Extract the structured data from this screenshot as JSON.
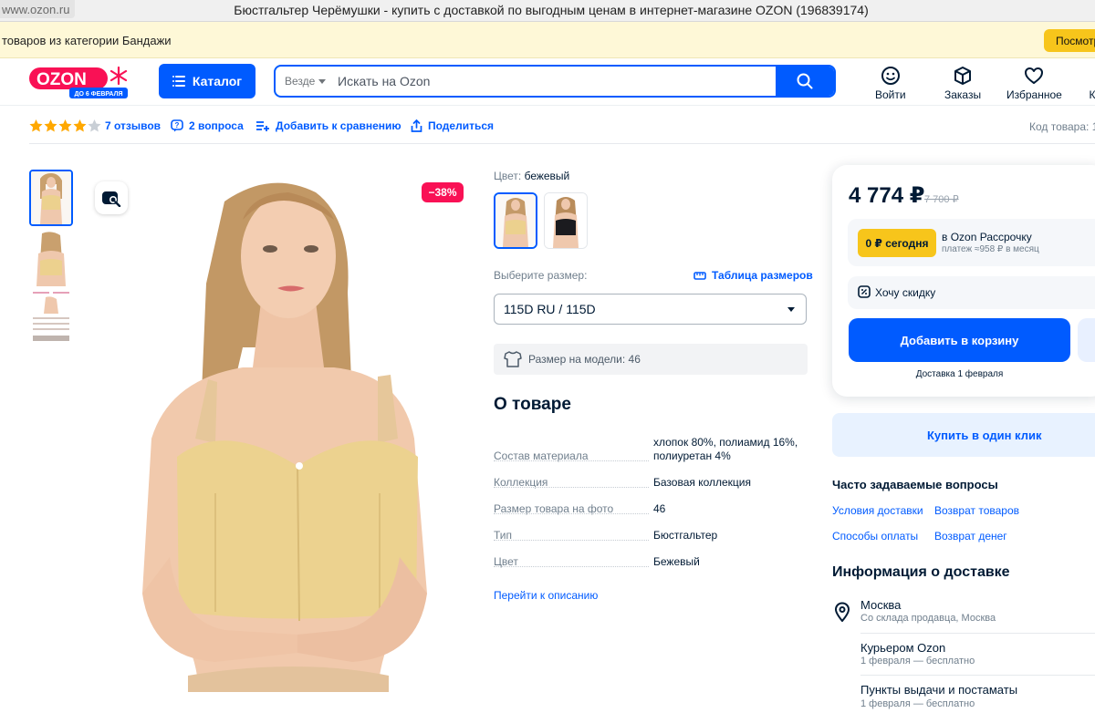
{
  "browser": {
    "url_text": "www.ozon.ru",
    "window_title": "Бюстгальтер Черёмушки - купить с доставкой по выгодным ценам в интернет-магазине OZON (196839174)"
  },
  "notice": {
    "text": "товаров из категории Бандажи",
    "button": "Посмотр"
  },
  "header": {
    "logo_text": "OZON",
    "logo_sub": "ДО 6 ФЕВРАЛЯ",
    "catalog_label": "Каталог",
    "search_scope": "Везде",
    "search_placeholder": "Искать на Ozon",
    "nav": [
      {
        "label": "Войти",
        "icon": "smile-icon"
      },
      {
        "label": "Заказы",
        "icon": "box-icon"
      },
      {
        "label": "Избранное",
        "icon": "heart-icon"
      },
      {
        "label": "К",
        "icon": "cart-icon"
      }
    ]
  },
  "rating": {
    "stars": 4,
    "reviews": "7 отзывов",
    "questions": "2 вопроса",
    "compare": "Добавить к сравнению",
    "share": "Поделиться",
    "code_label": "Код товара: 1"
  },
  "gallery": {
    "discount_badge": "−38%"
  },
  "product": {
    "color_label": "Цвет:",
    "color_value": "бежевый",
    "size_label": "Выберите размер:",
    "size_table": "Таблица размеров",
    "size_selected": "115D RU / 115D",
    "model_size": "Размер на модели: 46",
    "about_title": "О товаре",
    "attributes": [
      {
        "key": "Состав материала",
        "value": "хлопок 80%, полиамид 16%, полиуретан 4%"
      },
      {
        "key": "Коллекция",
        "value": "Базовая коллекция"
      },
      {
        "key": "Размер товара на фото",
        "value": "46"
      },
      {
        "key": "Тип",
        "value": "Бюстгальтер"
      },
      {
        "key": "Цвет",
        "value": "Бежевый"
      }
    ],
    "goto_description": "Перейти к описанию"
  },
  "buy": {
    "price": "4 774 ₽",
    "old_price": "7 700 ₽",
    "installment_chip": "0 ₽ сегодня",
    "installment_title": "в Ozon Рассрочку",
    "installment_sub": "платеж ≈958 ₽ в месяц",
    "want_discount": "Хочу скидку",
    "add_to_cart": "Добавить в корзину",
    "delivery_date": "Доставка 1 февраля",
    "one_click": "Купить в один клик"
  },
  "faq": {
    "title": "Часто задаваемые вопросы",
    "links": [
      "Условия доставки",
      "Возврат товаров",
      "Способы оплаты",
      "Возврат денег"
    ]
  },
  "delivery": {
    "title": "Информация о доставке",
    "items": [
      {
        "name": "Москва",
        "sub": "Со склада продавца, Москва"
      },
      {
        "name": "Курьером Ozon",
        "sub": "1 февраля — бесплатно"
      },
      {
        "name": "Пункты выдачи и постаматы",
        "sub": "1 февраля — бесплатно"
      }
    ]
  },
  "colors": {
    "accent": "#005bff",
    "badge": "#f91155",
    "yellow": "#f7c51b",
    "star": "#ffa800"
  }
}
